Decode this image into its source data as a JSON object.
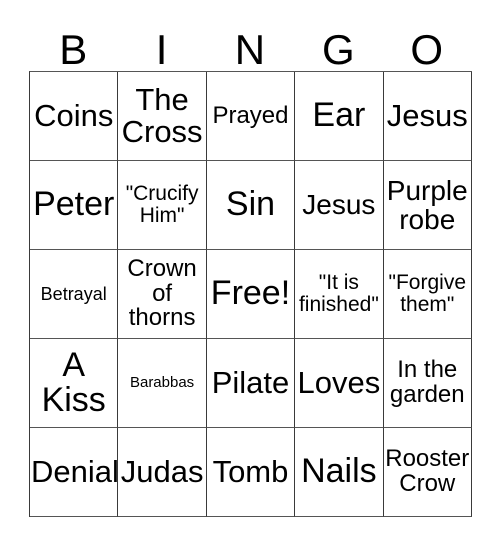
{
  "card": {
    "headers": [
      "B",
      "I",
      "N",
      "G",
      "O"
    ],
    "rows": [
      [
        {
          "text": "Coins",
          "size": "fs-lg"
        },
        {
          "text": "The\nCross",
          "size": "fs-lg"
        },
        {
          "text": "Prayed",
          "size": "fs-sm"
        },
        {
          "text": "Ear",
          "size": "fs-xl"
        },
        {
          "text": "Jesus",
          "size": "fs-lg"
        }
      ],
      [
        {
          "text": "Peter",
          "size": "fs-xl"
        },
        {
          "text": "\"Crucify\nHim\"",
          "size": "fs-xs"
        },
        {
          "text": "Sin",
          "size": "fs-xl"
        },
        {
          "text": "Jesus",
          "size": "fs-md"
        },
        {
          "text": "Purple\nrobe",
          "size": "fs-md"
        }
      ],
      [
        {
          "text": "Betrayal",
          "size": "fs-xxs"
        },
        {
          "text": "Crown\nof\nthorns",
          "size": "fs-sm"
        },
        {
          "text": "Free!",
          "size": "fs-xl"
        },
        {
          "text": "\"It is\nfinished\"",
          "size": "fs-xs"
        },
        {
          "text": "\"Forgive\nthem\"",
          "size": "fs-xs"
        }
      ],
      [
        {
          "text": "A\nKiss",
          "size": "fs-xl"
        },
        {
          "text": "Barabbas",
          "size": "fs-tiny"
        },
        {
          "text": "Pilate",
          "size": "fs-lg"
        },
        {
          "text": "Loves",
          "size": "fs-lg"
        },
        {
          "text": "In the\ngarden",
          "size": "fs-sm"
        }
      ],
      [
        {
          "text": "Denial",
          "size": "fs-lg"
        },
        {
          "text": "Judas",
          "size": "fs-lg"
        },
        {
          "text": "Tomb",
          "size": "fs-lg"
        },
        {
          "text": "Nails",
          "size": "fs-xl"
        },
        {
          "text": "Rooster\nCrow",
          "size": "fs-sm"
        }
      ]
    ]
  },
  "colors": {
    "background": "#ffffff",
    "cell_background": "#ffffff",
    "border": "#3a3a3a",
    "text": "#000000"
  }
}
